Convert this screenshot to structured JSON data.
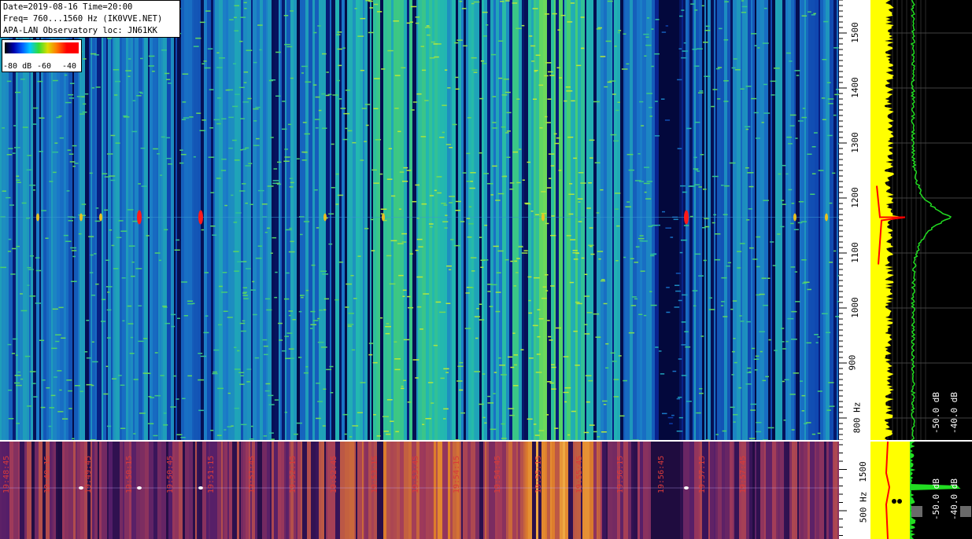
{
  "info": {
    "line1": "Date=2019-08-16 Time=20:00",
    "line2": "Freq= 760...1560 Hz (IK0VVE.NET)",
    "line3": "APA-LAN Observatory loc: JN61KK"
  },
  "colorscale": {
    "labels": [
      "-80 dB",
      "-60",
      "-40"
    ],
    "colors": [
      "#000000",
      "#0000aa",
      "#0060ff",
      "#00c8ff",
      "#33dd33",
      "#dddd00",
      "#ff7a00",
      "#ff0000"
    ]
  },
  "timestamps": [
    "19:48:45",
    "19:49:15",
    "19:49:45",
    "19:50:15",
    "19:50:45",
    "19:51:15",
    "19:51:45",
    "19:52:15",
    "19:52:45",
    "19:53:15",
    "19:53:45",
    "19:54:15",
    "19:54:45",
    "19:55:15",
    "19:55:45",
    "19:56:15",
    "19:56:45",
    "19:57:15",
    "19:57:45"
  ],
  "freq_axis_top": {
    "ticks": [
      "800 Hz",
      "900",
      "1000",
      "1100",
      "1200",
      "1300",
      "1400",
      "1500"
    ]
  },
  "freq_axis_bottom": {
    "ticks": [
      "500 Hz",
      "1500"
    ]
  },
  "spectrum_labels": {
    "top": [
      "-50.0 dB",
      "-40.0 dB"
    ],
    "bottom": [
      "-50.0 dB",
      "-40.0 dB"
    ]
  },
  "chart_data": {
    "type": "heatmap",
    "title": "",
    "xlabel": "",
    "ylabel": "",
    "ylim": [
      760,
      1560
    ],
    "signal_frequency_hz": 1165,
    "colors": {
      "background": "#000043",
      "dark_column": "#02022a",
      "bottom_background": "#160833",
      "bottom_warm": "#e8a022",
      "carrier": "#ff1a1a",
      "spectrum_yellow": "#ffff00",
      "spectrum_green": "#22dd22",
      "spectrum_red": "#ff0000"
    }
  }
}
